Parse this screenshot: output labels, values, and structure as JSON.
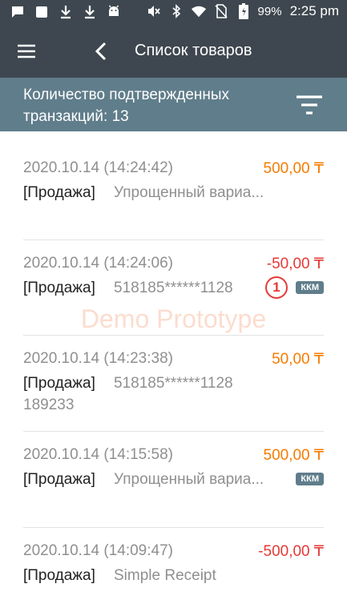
{
  "status_bar": {
    "battery": "99%",
    "time": "2:25 pm",
    "left_icons": [
      "message-icon",
      "square-icon",
      "download-icon",
      "download-icon",
      "android-icon"
    ],
    "right_icons": [
      "mute-icon",
      "bluetooth-icon",
      "wifi-icon",
      "no-sim-icon",
      "battery-charging-icon"
    ]
  },
  "appbar": {
    "title": "Список товаров",
    "menu_icon": "hamburger-menu-icon",
    "back_icon": "chevron-left-icon"
  },
  "subheader": {
    "text": "Количество подтвержденных транзакций: 13",
    "filter_icon": "filter-icon"
  },
  "watermark": "Demo Prototype",
  "colors": {
    "appbar": "#3e474f",
    "subheader": "#607d8b",
    "amount_orange": "#f57c00",
    "amount_red": "#e53935",
    "badge": "#607d8b"
  },
  "transactions": [
    {
      "date": "2020.10.14 (14:24:42)",
      "amount": "500,00 ₸",
      "amount_color": "#f57c00",
      "type": "[Продажа]",
      "desc": "Упрощенный вариа...",
      "desc2": "",
      "badge": "",
      "marker": ""
    },
    {
      "date": "2020.10.14 (14:24:06)",
      "amount": "-50,00 ₸",
      "amount_color": "#e53935",
      "type": "[Продажа]",
      "desc": "518185******1128",
      "desc2": "",
      "badge": "ККМ",
      "marker": "1"
    },
    {
      "date": "2020.10.14 (14:23:38)",
      "amount": "50,00 ₸",
      "amount_color": "#f57c00",
      "type": "[Продажа]",
      "desc": "518185******1128",
      "desc2": "189233",
      "badge": "",
      "marker": ""
    },
    {
      "date": "2020.10.14 (14:15:58)",
      "amount": "500,00 ₸",
      "amount_color": "#f57c00",
      "type": "[Продажа]",
      "desc": "Упрощенный вариа...",
      "desc2": "",
      "badge": "ККМ",
      "marker": ""
    },
    {
      "date": "2020.10.14 (14:09:47)",
      "amount": "-500,00 ₸",
      "amount_color": "#e53935",
      "type": "[Продажа]",
      "desc": "Simple Receipt",
      "desc2": "",
      "badge": "",
      "marker": ""
    }
  ]
}
